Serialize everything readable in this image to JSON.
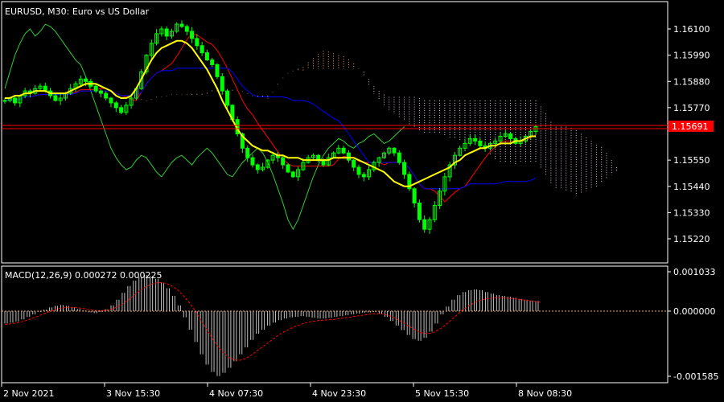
{
  "window": {
    "symbol": "EURUSD",
    "timeframe": "M30",
    "description": "Euro vs US Dollar",
    "title": "EURUSD, M30:  Euro vs US Dollar"
  },
  "colors": {
    "background": "#000000",
    "frame": "#ffffff",
    "candle": "#00ff00",
    "tenkan": "#ff0000",
    "kijun": "#0000ff",
    "chikou": "#32cd32",
    "kumo_bull": "#f4a460",
    "kumo_bear": "#d8bfd8",
    "moving_average": "#ffff00",
    "price_line": "#ff0000",
    "price_tag": "#ff0000",
    "macd_hist": "#c0c0c0",
    "macd_signal": "#ff0000"
  },
  "main_panel": {
    "price_axis_labels": [
      "1.16100",
      "1.15990",
      "1.15880",
      "1.15770",
      "1.15550",
      "1.15440",
      "1.15330",
      "1.15220"
    ],
    "current_price": "1.15691",
    "price_min": 1.515,
    "price_max": 1.16215
  },
  "macd_panel": {
    "title": "MACD(12,26,9) 0.000272 0.000225",
    "axis_labels": [
      "0.001033",
      "0.000000",
      "-0.001585"
    ]
  },
  "time_axis": {
    "labels": [
      "2 Nov 2021",
      "3 Nov 15:30",
      "4 Nov 07:30",
      "4 Nov 23:30",
      "5 Nov 15:30",
      "8 Nov 08:30"
    ]
  },
  "chart_data": {
    "type": "candlestick",
    "symbol": "EURUSD",
    "timeframe": "M30",
    "indicators": [
      "Ichimoku Kinko Hyo",
      "Moving Average",
      "MACD(12,26,9)"
    ],
    "macd_main": 0.000272,
    "macd_signal": 0.000225,
    "last_price": 1.15691,
    "close_series": [
      1.158,
      1.1581,
      1.1579,
      1.1582,
      1.1584,
      1.1583,
      1.1585,
      1.1586,
      1.1584,
      1.1582,
      1.158,
      1.1581,
      1.1583,
      1.1585,
      1.1587,
      1.1589,
      1.1588,
      1.1586,
      1.1584,
      1.1583,
      1.1581,
      1.1579,
      1.1577,
      1.1575,
      1.1578,
      1.1581,
      1.1585,
      1.1592,
      1.1599,
      1.1604,
      1.1608,
      1.161,
      1.1607,
      1.1609,
      1.1612,
      1.1611,
      1.1609,
      1.1606,
      1.1603,
      1.16,
      1.1597,
      1.1595,
      1.159,
      1.1584,
      1.1578,
      1.1572,
      1.1566,
      1.156,
      1.1556,
      1.1553,
      1.1551,
      1.1552,
      1.1555,
      1.1557,
      1.1556,
      1.1553,
      1.155,
      1.1548,
      1.1551,
      1.1554,
      1.1556,
      1.1557,
      1.1555,
      1.1553,
      1.1556,
      1.1558,
      1.156,
      1.1558,
      1.1555,
      1.1552,
      1.1549,
      1.1548,
      1.1551,
      1.1554,
      1.1556,
      1.1558,
      1.156,
      1.1558,
      1.1554,
      1.1549,
      1.1543,
      1.1537,
      1.153,
      1.1526,
      1.153,
      1.1536,
      1.1542,
      1.1548,
      1.1553,
      1.1557,
      1.156,
      1.1562,
      1.1564,
      1.1563,
      1.1561,
      1.156,
      1.1562,
      1.1563,
      1.1565,
      1.1566,
      1.1564,
      1.1562,
      1.1563,
      1.1565,
      1.1567,
      1.1569
    ],
    "ma_series": [
      1.1581,
      1.1581,
      1.1582,
      1.1582,
      1.1583,
      1.1583,
      1.1584,
      1.1584,
      1.1584,
      1.1583,
      1.1583,
      1.1583,
      1.1583,
      1.1584,
      1.1585,
      1.1586,
      1.1587,
      1.1587,
      1.1587,
      1.1586,
      1.1585,
      1.1584,
      1.1582,
      1.1581,
      1.1581,
      1.1582,
      1.1585,
      1.1589,
      1.1593,
      1.1597,
      1.16,
      1.1602,
      1.1603,
      1.1604,
      1.1605,
      1.1605,
      1.1604,
      1.1602,
      1.1599,
      1.1596,
      1.1593,
      1.1589,
      1.1585,
      1.158,
      1.1576,
      1.1572,
      1.1568,
      1.1565,
      1.1563,
      1.1561,
      1.156,
      1.1559,
      1.1559,
      1.1558,
      1.1557,
      1.1557,
      1.1556,
      1.1556,
      1.1556,
      1.1555,
      1.1555,
      1.1555,
      1.1555,
      1.1555,
      1.1555,
      1.1556,
      1.1556,
      1.1556,
      1.1556,
      1.1556,
      1.1555,
      1.1554,
      1.1553,
      1.1552,
      1.1551,
      1.155,
      1.1548,
      1.1546,
      1.1545,
      1.1544,
      1.1544,
      1.1545,
      1.1546,
      1.1547,
      1.1548,
      1.1549,
      1.155,
      1.1551,
      1.1552,
      1.1554,
      1.1555,
      1.1557,
      1.1558,
      1.1559,
      1.156,
      1.156,
      1.1561,
      1.1561,
      1.1562,
      1.1562,
      1.1562,
      1.1563,
      1.1563,
      1.1564,
      1.1565,
      1.1565
    ],
    "macd_hist": [
      -0.0003,
      -0.00028,
      -0.00025,
      -0.0002,
      -0.00014,
      -8e-05,
      -2e-05,
      4e-05,
      0.0001,
      0.00014,
      0.00016,
      0.00014,
      0.0001,
      6e-05,
      2e-05,
      -3e-05,
      -5e-05,
      -2e-05,
      5e-05,
      0.00015,
      0.0003,
      0.00048,
      0.00066,
      0.0008,
      0.0009,
      0.00095,
      0.00092,
      0.00085,
      0.00075,
      0.0006,
      0.0004,
      0.00015,
      -0.00015,
      -0.00045,
      -0.00075,
      -0.00105,
      -0.0013,
      -0.00148,
      -0.00158,
      -0.0015,
      -0.00138,
      -0.00122,
      -0.00105,
      -0.00088,
      -0.0007,
      -0.00055,
      -0.00045,
      -0.00035,
      -0.00028,
      -0.00022,
      -0.00018,
      -0.00015,
      -0.00014,
      -0.00012,
      -0.00014,
      -0.00016,
      -0.00018,
      -0.00018,
      -0.00016,
      -0.00014,
      -0.00012,
      -0.0001,
      -8e-05,
      -6e-05,
      -4e-05,
      -3e-05,
      -2e-05,
      -6e-05,
      -0.00014,
      -0.00024,
      -0.00035,
      -0.00046,
      -0.00058,
      -0.00068,
      -0.00072,
      -0.00065,
      -0.0005,
      -0.0003,
      -8e-05,
      0.00012,
      0.0003,
      0.00042,
      0.0005,
      0.00055,
      0.00057,
      0.00055,
      0.0005,
      0.00046,
      0.00042,
      0.0004,
      0.00038,
      0.00035,
      0.00032,
      0.0003,
      0.00028,
      0.00027
    ],
    "macd_signal_series": [
      -0.00032,
      -0.00031,
      -0.00029,
      -0.00026,
      -0.00022,
      -0.00017,
      -0.00012,
      -6e-05,
      -1e-05,
      4e-05,
      8e-05,
      0.0001,
      0.0001,
      9e-05,
      7e-05,
      4e-05,
      2e-05,
      1e-05,
      2e-05,
      5e-05,
      0.0001,
      0.00018,
      0.00028,
      0.0004,
      0.00052,
      0.00062,
      0.0007,
      0.00074,
      0.00075,
      0.00072,
      0.00065,
      0.00055,
      0.0004,
      0.00022,
      2e-05,
      -0.0002,
      -0.00042,
      -0.00064,
      -0.00084,
      -0.001,
      -0.00112,
      -0.00118,
      -0.0012,
      -0.00116,
      -0.00108,
      -0.00098,
      -0.00088,
      -0.00078,
      -0.00068,
      -0.00058,
      -0.0005,
      -0.00043,
      -0.00037,
      -0.00032,
      -0.00028,
      -0.00025,
      -0.00023,
      -0.00022,
      -0.00021,
      -0.0002,
      -0.00018,
      -0.00016,
      -0.00014,
      -0.00012,
      -0.0001,
      -8e-05,
      -6e-05,
      -6e-05,
      -8e-05,
      -0.00012,
      -0.00018,
      -0.00026,
      -0.00034,
      -0.00042,
      -0.0005,
      -0.00054,
      -0.00054,
      -0.0005,
      -0.00042,
      -0.00032,
      -0.0002,
      -8e-05,
      4e-05,
      0.00014,
      0.00022,
      0.00028,
      0.00032,
      0.00034,
      0.00035,
      0.00035,
      0.00034,
      0.00033,
      0.00031,
      0.00029,
      0.00027,
      0.00025,
      0.00023
    ]
  }
}
